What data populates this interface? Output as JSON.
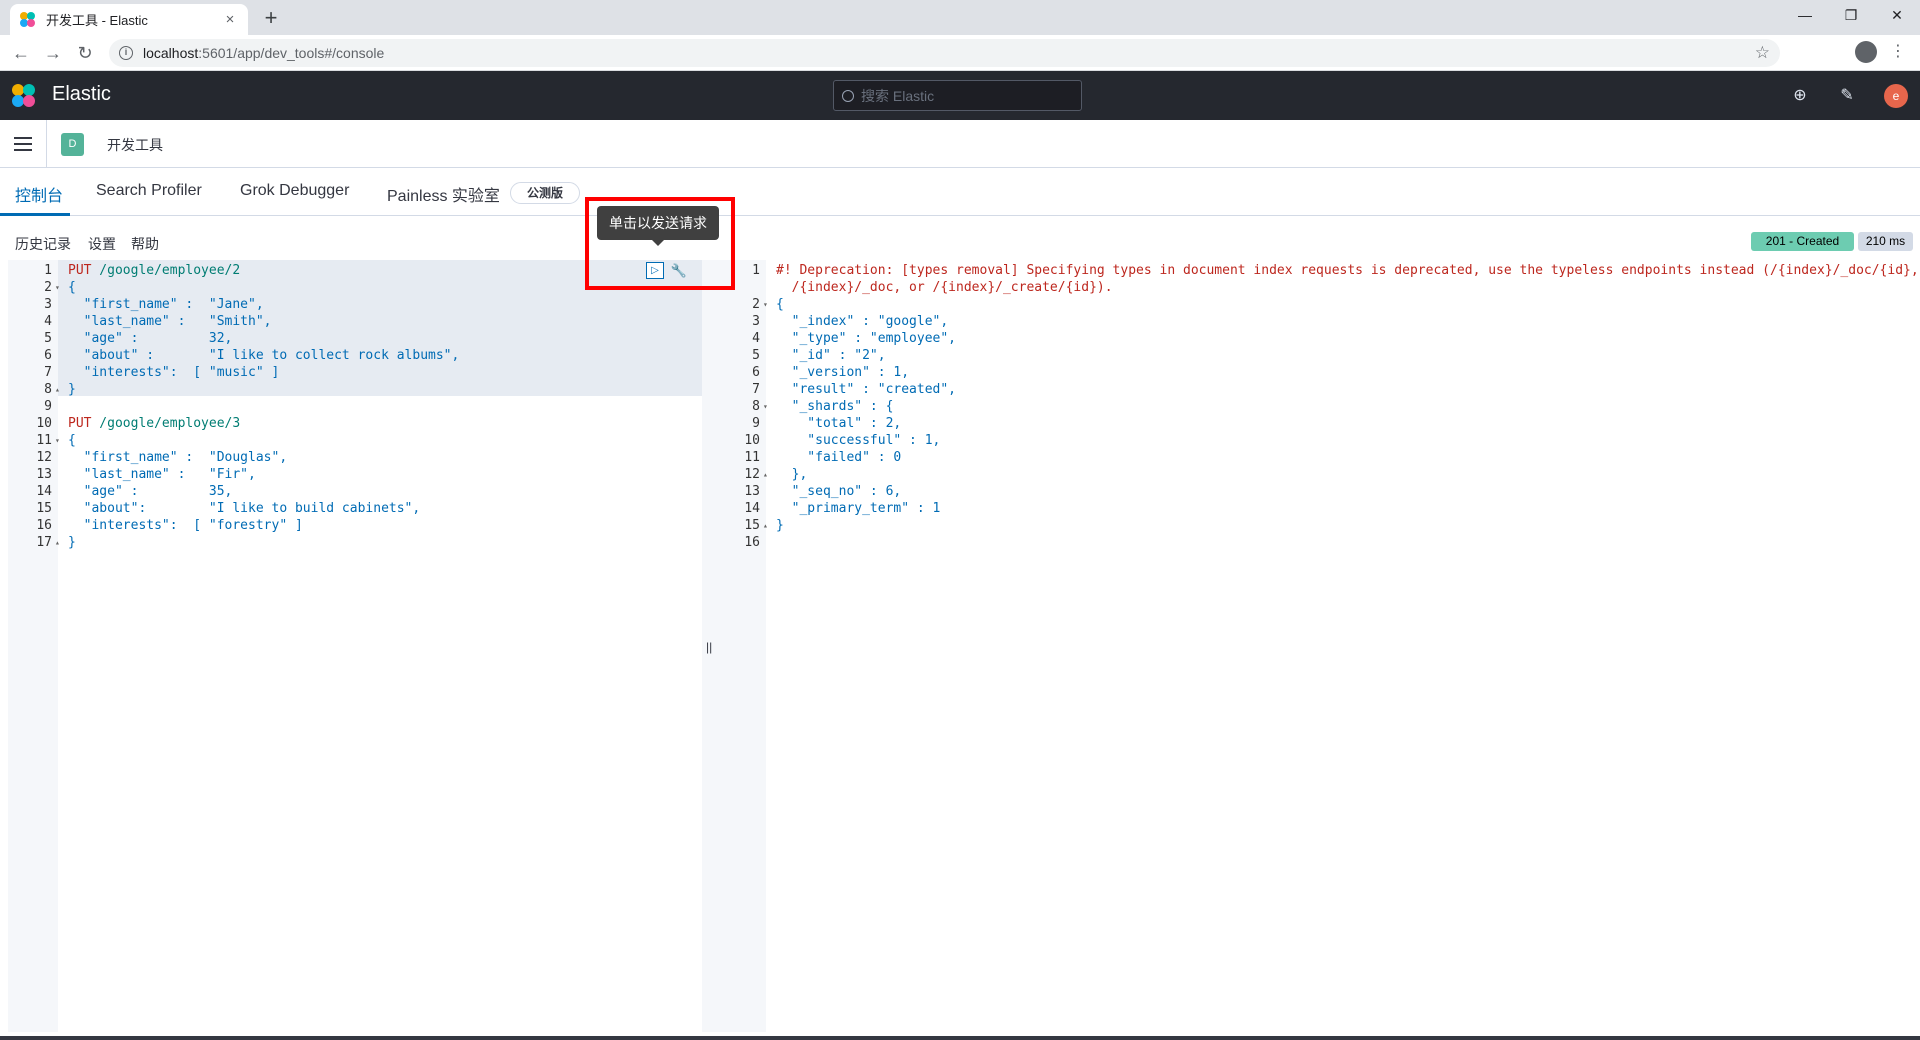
{
  "browser": {
    "tab_title": "开发工具 - Elastic",
    "tab_close": "×",
    "new_tab": "+",
    "win_minimize": "—",
    "win_restore": "❐",
    "win_close": "✕",
    "back": "←",
    "forward": "→",
    "reload": "↻",
    "url_host": "localhost",
    "url_path": ":5601/app/dev_tools#/console",
    "star": "☆",
    "menu": "⋮"
  },
  "kibana": {
    "brand": "Elastic",
    "search_placeholder": "搜索 Elastic",
    "avatar": "e",
    "help_icon": "⊕",
    "news_icon": "✎"
  },
  "breadcrumb": {
    "space": "D",
    "current": "开发工具"
  },
  "devtools_tabs": [
    {
      "label": "控制台",
      "active": true
    },
    {
      "label": "Search Profiler",
      "active": false
    },
    {
      "label": "Grok Debugger",
      "active": false
    },
    {
      "label": "Painless 实验室",
      "active": false
    }
  ],
  "beta_badge": "公测版",
  "console_menu": {
    "history": "历史记录",
    "settings": "设置",
    "help": "帮助"
  },
  "response_status": {
    "status": "201 - Created",
    "timing": "210 ms",
    "status_color": "#6dccb1"
  },
  "tooltip": "单击以发送请求",
  "run_icon": "▷",
  "wrench_icon": "🔧",
  "resizer_glyph": "||",
  "request_lines": [
    {
      "n": "1",
      "fold": "",
      "method": "PUT",
      "path": " /google/employee/2",
      "text": ""
    },
    {
      "n": "2",
      "fold": "▾",
      "text": "{"
    },
    {
      "n": "3",
      "fold": "",
      "text": "  \"first_name\" :  \"Jane\","
    },
    {
      "n": "4",
      "fold": "",
      "text": "  \"last_name\" :   \"Smith\","
    },
    {
      "n": "5",
      "fold": "",
      "text": "  \"age\" :         32,"
    },
    {
      "n": "6",
      "fold": "",
      "text": "  \"about\" :       \"I like to collect rock albums\","
    },
    {
      "n": "7",
      "fold": "",
      "text": "  \"interests\":  [ \"music\" ]"
    },
    {
      "n": "8",
      "fold": "▴",
      "text": "}"
    },
    {
      "n": "9",
      "fold": "",
      "text": ""
    },
    {
      "n": "10",
      "fold": "",
      "method": "PUT",
      "path": " /google/employee/3",
      "text": ""
    },
    {
      "n": "11",
      "fold": "▾",
      "text": "{"
    },
    {
      "n": "12",
      "fold": "",
      "text": "  \"first_name\" :  \"Douglas\","
    },
    {
      "n": "13",
      "fold": "",
      "text": "  \"last_name\" :   \"Fir\","
    },
    {
      "n": "14",
      "fold": "",
      "text": "  \"age\" :         35,"
    },
    {
      "n": "15",
      "fold": "",
      "text": "  \"about\":        \"I like to build cabinets\","
    },
    {
      "n": "16",
      "fold": "",
      "text": "  \"interests\":  [ \"forestry\" ]"
    },
    {
      "n": "17",
      "fold": "▴",
      "text": "}"
    }
  ],
  "response_lines": [
    {
      "n": "1",
      "fold": "",
      "text": "#! Deprecation: [types removal] Specifying types in document index requests is deprecated, use the typeless endpoints instead (/{index}/_doc/{id},",
      "comment": true
    },
    {
      "n": "",
      "fold": "",
      "text": "  /{index}/_doc, or /{index}/_create/{id}).",
      "comment": true
    },
    {
      "n": "2",
      "fold": "▾",
      "text": "{"
    },
    {
      "n": "3",
      "fold": "",
      "text": "  \"_index\" : \"google\","
    },
    {
      "n": "4",
      "fold": "",
      "text": "  \"_type\" : \"employee\","
    },
    {
      "n": "5",
      "fold": "",
      "text": "  \"_id\" : \"2\","
    },
    {
      "n": "6",
      "fold": "",
      "text": "  \"_version\" : 1,"
    },
    {
      "n": "7",
      "fold": "",
      "text": "  \"result\" : \"created\","
    },
    {
      "n": "8",
      "fold": "▾",
      "text": "  \"_shards\" : {"
    },
    {
      "n": "9",
      "fold": "",
      "text": "    \"total\" : 2,"
    },
    {
      "n": "10",
      "fold": "",
      "text": "    \"successful\" : 1,"
    },
    {
      "n": "11",
      "fold": "",
      "text": "    \"failed\" : 0"
    },
    {
      "n": "12",
      "fold": "▴",
      "text": "  },"
    },
    {
      "n": "13",
      "fold": "",
      "text": "  \"_seq_no\" : 6,"
    },
    {
      "n": "14",
      "fold": "",
      "text": "  \"_primary_term\" : 1"
    },
    {
      "n": "15",
      "fold": "▴",
      "text": "}"
    },
    {
      "n": "16",
      "fold": "",
      "text": ""
    }
  ]
}
